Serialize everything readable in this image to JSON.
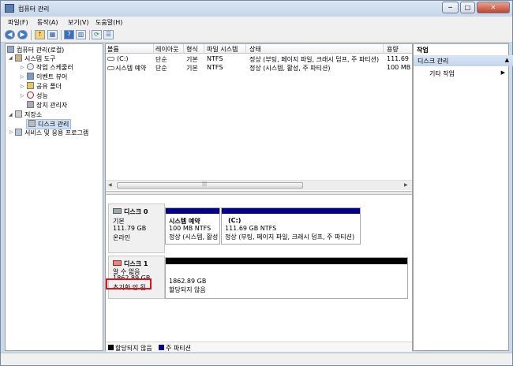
{
  "window": {
    "title": "컴퓨터 관리",
    "min": "─",
    "max": "□",
    "close": "✕"
  },
  "menu": [
    "파일(F)",
    "동작(A)",
    "보기(V)",
    "도움말(H)"
  ],
  "toolbar": {
    "back": "◀",
    "fwd": "▶",
    "up": "↑",
    "view": "▦",
    "help": "?",
    "pane": "▥",
    "refresh": "⟳",
    "props": "☰"
  },
  "tree": {
    "root": "컴퓨터 관리(로컬)",
    "system_tools": "시스템 도구",
    "task_scheduler": "작업 스케줄러",
    "event_viewer": "이벤트 뷰어",
    "shared_folders": "공유 폴더",
    "performance": "성능",
    "device_manager": "장치 관리자",
    "storage": "저장소",
    "disk_management": "디스크 관리",
    "services": "서비스 및 응용 프로그램"
  },
  "columns": [
    "볼륨",
    "레이아웃",
    "형식",
    "파일 시스템",
    "상태",
    "용량"
  ],
  "volumes": [
    {
      "name": "(C:)",
      "layout": "단순",
      "type": "기본",
      "fs": "NTFS",
      "status": "정상 (부팅, 페이지 파일, 크래시 덤프, 주 파티션)",
      "size": "111.69 ("
    },
    {
      "name": "시스템 예약",
      "layout": "단순",
      "type": "기본",
      "fs": "NTFS",
      "status": "정상 (시스템, 활성, 주 파티션)",
      "size": "100 MB"
    }
  ],
  "disk0": {
    "name": "디스크 0",
    "type": "기본",
    "size": "111.79 GB",
    "state": "온라인",
    "partitions": [
      {
        "title": "시스템 예약",
        "size": "100 MB NTFS",
        "status": "정상 (시스템, 활성"
      },
      {
        "title": "(C:)",
        "size": "111.69 GB NTFS",
        "status": "정상 (부팅, 페이지 파일, 크래시 덤프, 주 파티션)"
      }
    ]
  },
  "disk1": {
    "name": "디스크 1",
    "type": "알 수 없음",
    "size": "1862.89 GB",
    "state": "초기화 안 됨",
    "partition": {
      "size": "1862.89 GB",
      "status": "할당되지 않음"
    }
  },
  "legend": {
    "unallocated": "할당되지 않음",
    "primary": "주 파티션",
    "unalloc_color": "#000000",
    "primary_color": "#00008b"
  },
  "actions": {
    "header": "작업",
    "selected": "디스크 관리",
    "more": "기타 작업",
    "arrow_up": "▲",
    "arrow_right": "▶"
  }
}
